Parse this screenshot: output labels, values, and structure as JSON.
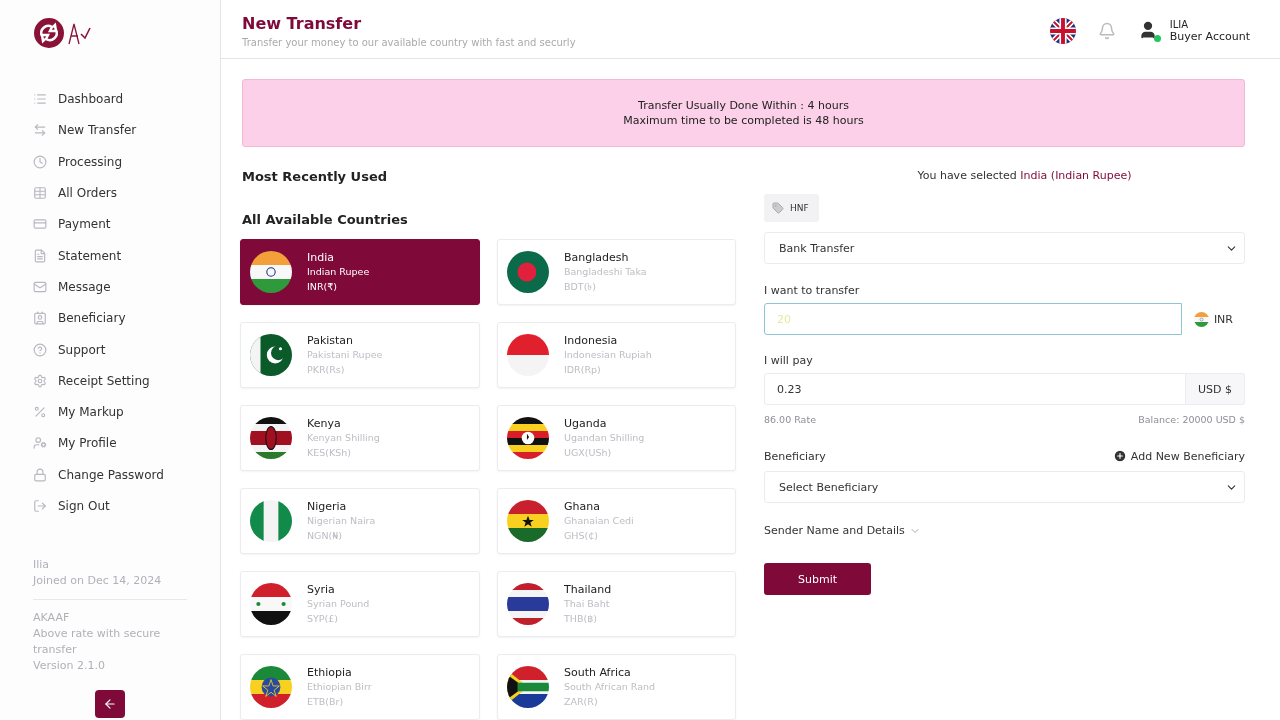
{
  "sidebar": {
    "items": [
      {
        "label": "Dashboard",
        "selected": false
      },
      {
        "label": "New Transfer",
        "selected": false
      },
      {
        "label": "Processing",
        "selected": false
      },
      {
        "label": "All Orders",
        "selected": false
      },
      {
        "label": "Payment",
        "selected": false
      },
      {
        "label": "Statement",
        "selected": false
      },
      {
        "label": "Message",
        "selected": false
      },
      {
        "label": "Beneficiary",
        "selected": false
      },
      {
        "label": "Support",
        "selected": false
      },
      {
        "label": "Receipt Setting",
        "selected": false
      },
      {
        "label": "My Markup",
        "selected": false
      },
      {
        "label": "My Profile",
        "selected": false
      },
      {
        "label": "Change Password",
        "selected": false
      },
      {
        "label": "Sign Out",
        "selected": false
      }
    ],
    "user_name": "Ilia",
    "joined": "Joined on Dec 14, 2024",
    "app_name": "AKAAF",
    "tagline": "Above rate with secure transfer",
    "version": "Version 2.1.0"
  },
  "header": {
    "title": "New Transfer",
    "subtitle": "Transfer your money to our available country with fast and securly",
    "user_name": "ILIA",
    "account_type": "Buyer Account",
    "online": true
  },
  "notice": [
    "Transfer Usually Done Within : 4 hours",
    "Maximum time to be completed is 48 hours"
  ],
  "recent_heading": "Most Recently Used",
  "countries_heading": "All Available Countries",
  "countries": [
    {
      "name": "India",
      "currency": "Indian Rupee",
      "code": "INR(₹)",
      "kind": "india",
      "selected": true
    },
    {
      "name": "Bangladesh",
      "currency": "Bangladeshi Taka",
      "code": "BDT(৳)",
      "kind": "bangladesh",
      "selected": false
    },
    {
      "name": "Pakistan",
      "currency": "Pakistani Rupee",
      "code": "PKR(Rs)",
      "kind": "pakistan",
      "selected": false
    },
    {
      "name": "Indonesia",
      "currency": "Indonesian Rupiah",
      "code": "IDR(Rp)",
      "kind": "indonesia",
      "selected": false
    },
    {
      "name": "Kenya",
      "currency": "Kenyan Shilling",
      "code": "KES(KSh)",
      "kind": "kenya",
      "selected": false
    },
    {
      "name": "Uganda",
      "currency": "Ugandan Shilling",
      "code": "UGX(USh)",
      "kind": "uganda",
      "selected": false
    },
    {
      "name": "Nigeria",
      "currency": "Nigerian Naira",
      "code": "NGN(₦)",
      "kind": "nigeria",
      "selected": false
    },
    {
      "name": "Ghana",
      "currency": "Ghanaian Cedi",
      "code": "GHS(₵)",
      "kind": "ghana",
      "selected": false
    },
    {
      "name": "Syria",
      "currency": "Syrian Pound",
      "code": "SYP(£)",
      "kind": "syria",
      "selected": false
    },
    {
      "name": "Thailand",
      "currency": "Thai Baht",
      "code": "THB(฿)",
      "kind": "thailand",
      "selected": false
    },
    {
      "name": "Ethiopia",
      "currency": "Ethiopian Birr",
      "code": "ETB(Br)",
      "kind": "ethiopia",
      "selected": false
    },
    {
      "name": "South Africa",
      "currency": "South African Rand",
      "code": "ZAR(R)",
      "kind": "southafrica",
      "selected": false
    }
  ],
  "form": {
    "selected_prefix": "You have selected",
    "selected_country": "India (Indian Rupee)",
    "tag": "HNF",
    "method": "Bank Transfer",
    "transfer_label": "I want to transfer",
    "transfer_placeholder": "20",
    "transfer_currency": "INR",
    "pay_label": "I will pay",
    "pay_value": "0.23",
    "pay_currency": "USD $",
    "rate": "86.00 Rate",
    "balance": "Balance: 20000 USD $",
    "beneficiary_label": "Beneficiary",
    "add_beneficiary": "Add New Beneficiary",
    "beneficiary_placeholder": "Select Beneficiary",
    "sender_toggle": "Sender Name and Details",
    "submit": "Submit"
  }
}
